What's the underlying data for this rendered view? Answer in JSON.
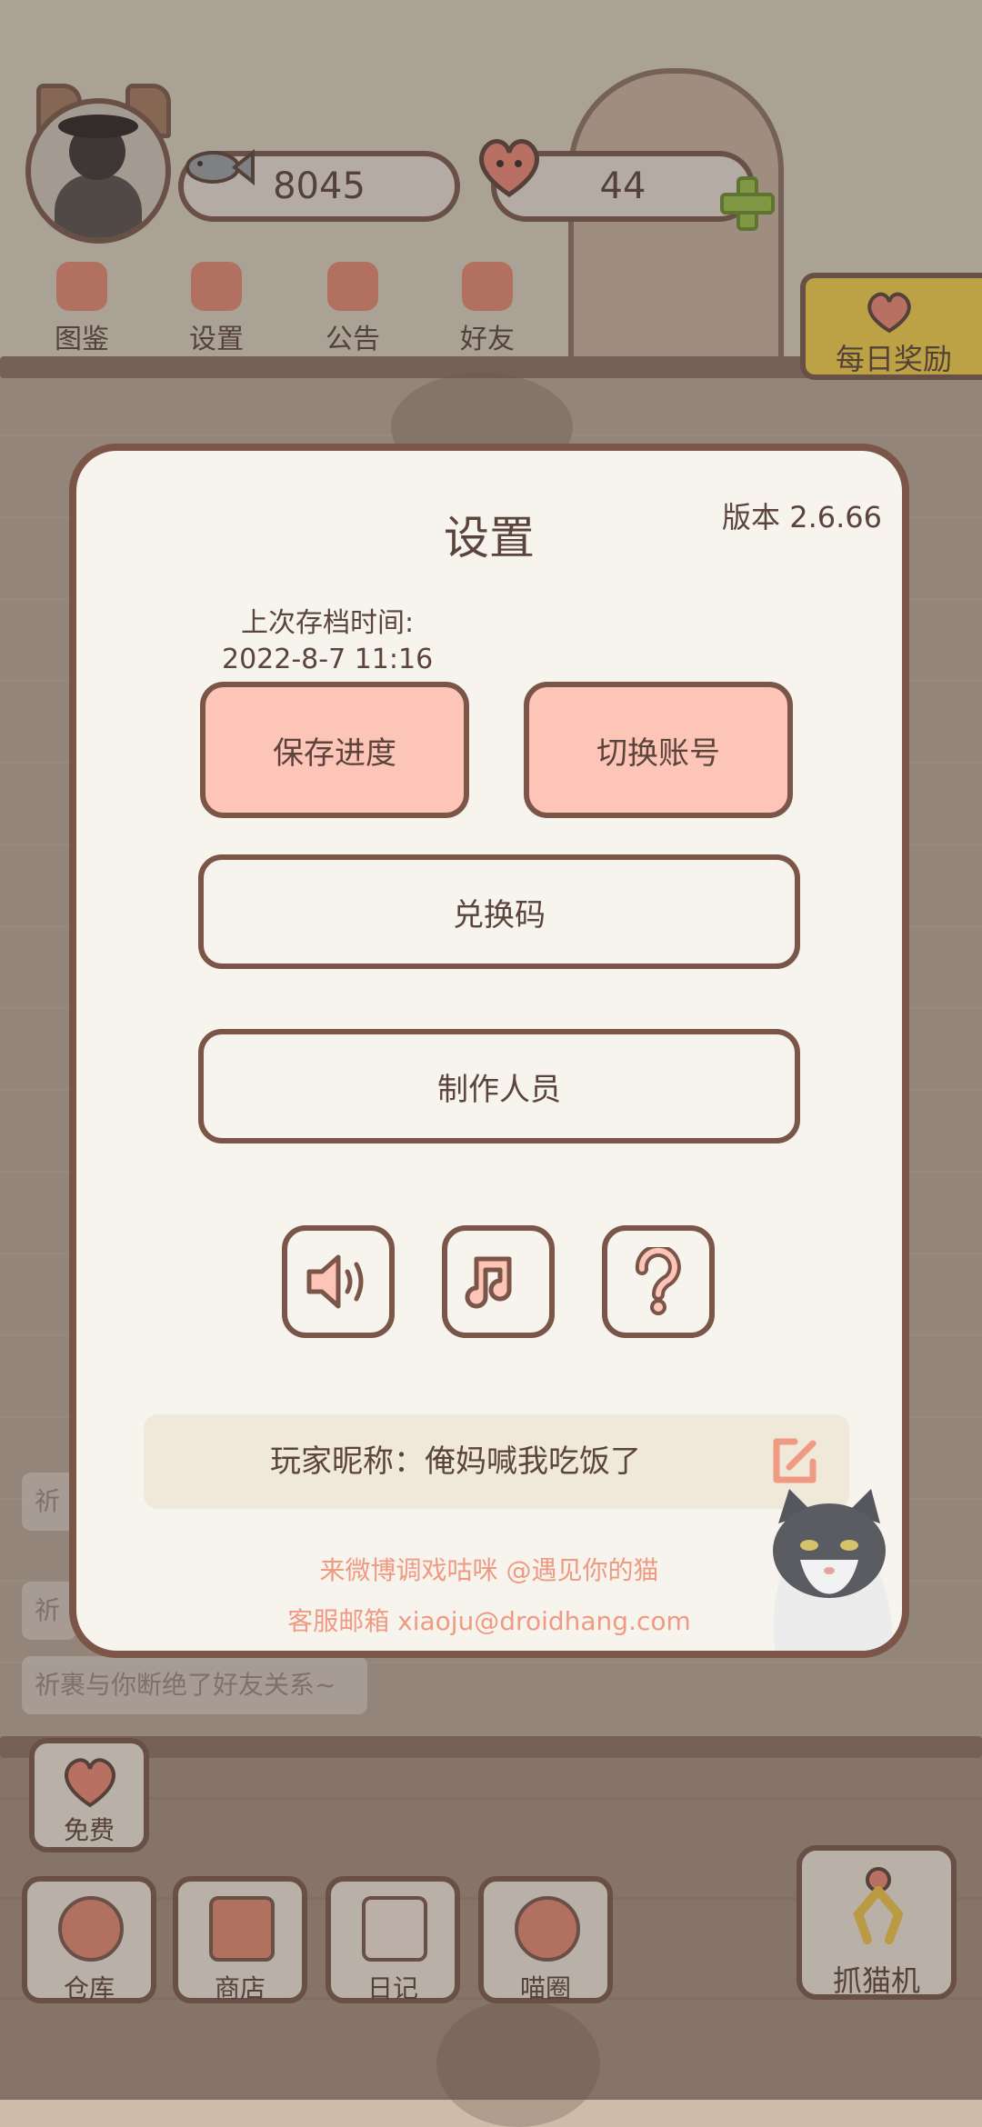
{
  "hud": {
    "fish_count": "8045",
    "heart_count": "44",
    "nav": [
      {
        "label": "图鉴",
        "icon": "cat-book-icon"
      },
      {
        "label": "设置",
        "icon": "gear-icon"
      },
      {
        "label": "公告",
        "icon": "gift-icon"
      },
      {
        "label": "好友",
        "icon": "friends-icon"
      }
    ],
    "daily_reward_label": "每日奖励"
  },
  "bottom": {
    "free_label": "免费",
    "buttons": [
      {
        "label": "仓库",
        "icon": "storage-icon"
      },
      {
        "label": "商店",
        "icon": "shop-icon"
      },
      {
        "label": "日记",
        "icon": "diary-icon"
      },
      {
        "label": "喵圈",
        "icon": "cat-circle-icon"
      }
    ],
    "claw_label": "抓猫机"
  },
  "chat": {
    "messages": [
      "祈",
      "祈",
      "祈裹与你断绝了好友关系~"
    ]
  },
  "settings": {
    "title": "设置",
    "version": "版本 2.6.66",
    "last_save_label": "上次存档时间:",
    "last_save_time": "2022-8-7 11:16",
    "save_button": "保存进度",
    "switch_account_button": "切换账号",
    "redeem_code_button": "兑换码",
    "credits_button": "制作人员",
    "icons": [
      "sound-icon",
      "music-icon",
      "help-icon"
    ],
    "nickname": "玩家昵称：俺妈喊我吃饭了",
    "weibo_line": "来微博调戏咕咪 @遇见你的猫",
    "email_line": "客服邮箱 xiaoju@droidhang.com"
  },
  "colors": {
    "pink_button": "#fdc5b7",
    "border_brown": "#7a5548",
    "panel": "#f7f4ee",
    "footer_text": "#ef9a82"
  }
}
